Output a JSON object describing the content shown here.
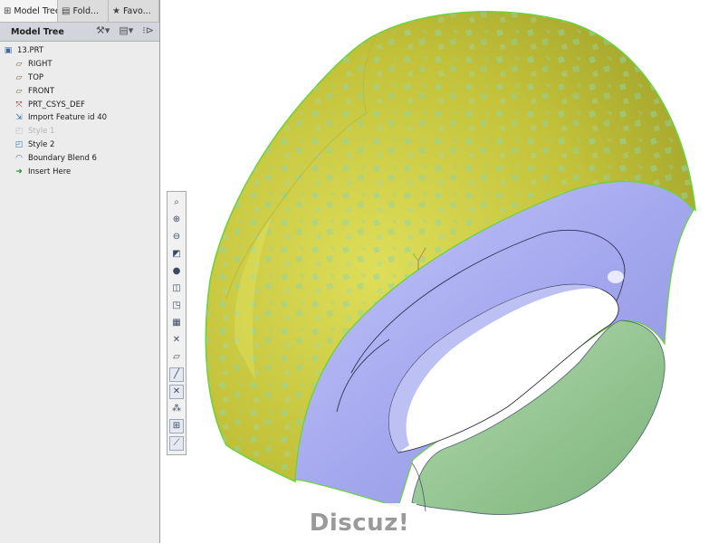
{
  "tabs": [
    {
      "label": "Model Tree",
      "icon": "model-tree-icon"
    },
    {
      "label": "Fold...",
      "icon": "folder-icon"
    },
    {
      "label": "Favo...",
      "icon": "favorites-icon"
    }
  ],
  "tree_toolbar": {
    "title": "Model Tree"
  },
  "tree": {
    "items": [
      {
        "label": "13.PRT",
        "icon": "part-icon",
        "level": 0,
        "suppressed": false
      },
      {
        "label": "RIGHT",
        "icon": "datum-plane-icon",
        "level": 1,
        "suppressed": false
      },
      {
        "label": "TOP",
        "icon": "datum-plane-icon",
        "level": 1,
        "suppressed": false
      },
      {
        "label": "FRONT",
        "icon": "datum-plane-icon",
        "level": 1,
        "suppressed": false
      },
      {
        "label": "PRT_CSYS_DEF",
        "icon": "csys-icon",
        "level": 1,
        "suppressed": false
      },
      {
        "label": "Import Feature id 40",
        "icon": "import-feature-icon",
        "level": 1,
        "suppressed": false
      },
      {
        "label": "Style 1",
        "icon": "style-icon",
        "level": 1,
        "suppressed": true
      },
      {
        "label": "Style 2",
        "icon": "style-icon",
        "level": 1,
        "suppressed": false
      },
      {
        "label": "Boundary Blend 6",
        "icon": "boundary-blend-icon",
        "level": 1,
        "suppressed": false
      },
      {
        "label": "Insert Here",
        "icon": "insert-arrow-icon",
        "level": 1,
        "suppressed": false
      }
    ]
  },
  "view_toolbar": {
    "buttons": [
      "refit-icon",
      "zoom-in-icon",
      "zoom-out-icon",
      "repaint-icon",
      "display-style-icon",
      "saved-views-icon",
      "view-manager-icon",
      "perspective-icon",
      "spin-center-icon",
      "annotation-display-icon",
      "plane-display-icon",
      "axis-display-icon",
      "point-display-icon",
      "csys-display-icon",
      "sketch-display-icon"
    ]
  },
  "watermark": {
    "text": "Discuz!"
  },
  "colors": {
    "surface_yellow": "#c8c83c",
    "surface_blue": "#a8acee",
    "surface_green": "#9ccc9a",
    "edge_highlight": "#7ae04a",
    "sidebar_bg": "#ececec"
  }
}
